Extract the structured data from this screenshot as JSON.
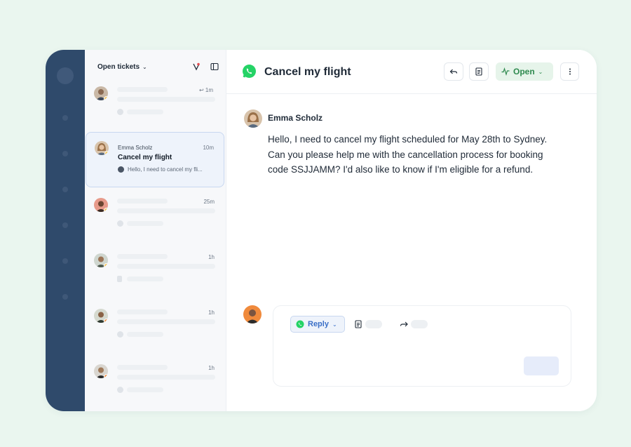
{
  "colors": {
    "background": "#eaf6ef",
    "rail": "#2f4a6b",
    "accent_green": "#2f8a4f",
    "accent_blue": "#3a6fc7",
    "whatsapp": "#25d366"
  },
  "list": {
    "title": "Open tickets",
    "caret": "⌄",
    "tickets": [
      {
        "time": "1m",
        "time_icon": "reply-arrow-icon"
      },
      {
        "name": "Emma Scholz",
        "subject": "Cancel my flight",
        "preview": "Hello, I need to cancel my fli...",
        "time": "10m",
        "channel": "whatsapp-icon"
      },
      {
        "time": "25m"
      },
      {
        "time": "1h"
      },
      {
        "time": "1h"
      },
      {
        "time": "1h"
      }
    ]
  },
  "ticket": {
    "title": "Cancel my flight",
    "channel_icon": "whatsapp-icon",
    "status": "Open",
    "status_caret": "⌄"
  },
  "message": {
    "author": "Emma Scholz",
    "body": "Hello, I need to cancel my flight scheduled for May 28th to Sydney. Can you please help me with the cancellation process for booking code SSJJAMM? I'd also like to know if I'm eligible for a refund."
  },
  "composer": {
    "reply_label": "Reply",
    "reply_caret": "⌄"
  }
}
